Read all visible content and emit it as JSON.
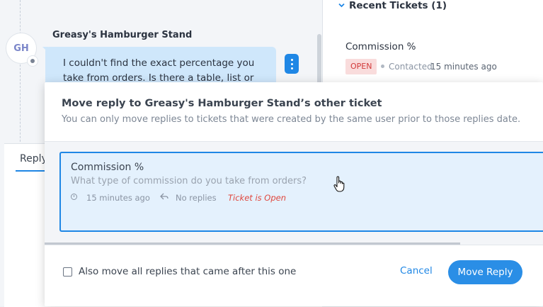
{
  "conversation": {
    "avatar_initials": "GH",
    "sender": "Greasy's Hamburger Stand",
    "message": "I couldn't find the exact percentage you take from orders. Is there a table, list or",
    "reply_tab": "Reply"
  },
  "sidebar": {
    "recent_tickets_label": "Recent Tickets (1)",
    "ticket": {
      "title": "Commission %",
      "status_badge": "OPEN",
      "contacted_label": "Contacted",
      "time": "15 minutes ago"
    }
  },
  "modal": {
    "title": "Move reply to Greasy's Hamburger Stand’s other ticket",
    "subtitle": "You can only move replies to tickets that were created by the same user prior to those replies date.",
    "ticket_card": {
      "title": "Commission %",
      "subtitle": "What type of commission do you take from orders?",
      "time": "15 minutes ago",
      "replies": "No replies",
      "status": "Ticket is Open"
    },
    "checkbox_label": "Also move all replies that came after this one",
    "cancel_label": "Cancel",
    "move_label": "Move Reply"
  },
  "icons": [
    "user-icon",
    "more-vertical-icon",
    "chevron-down-icon",
    "clock-icon",
    "reply-icon",
    "hand-pointer-cursor"
  ],
  "colors": {
    "accent": "#1f87e5",
    "open_badge_bg": "#f9dcdc",
    "open_badge_text": "#d23a3a",
    "status_red": "#e0453c"
  }
}
